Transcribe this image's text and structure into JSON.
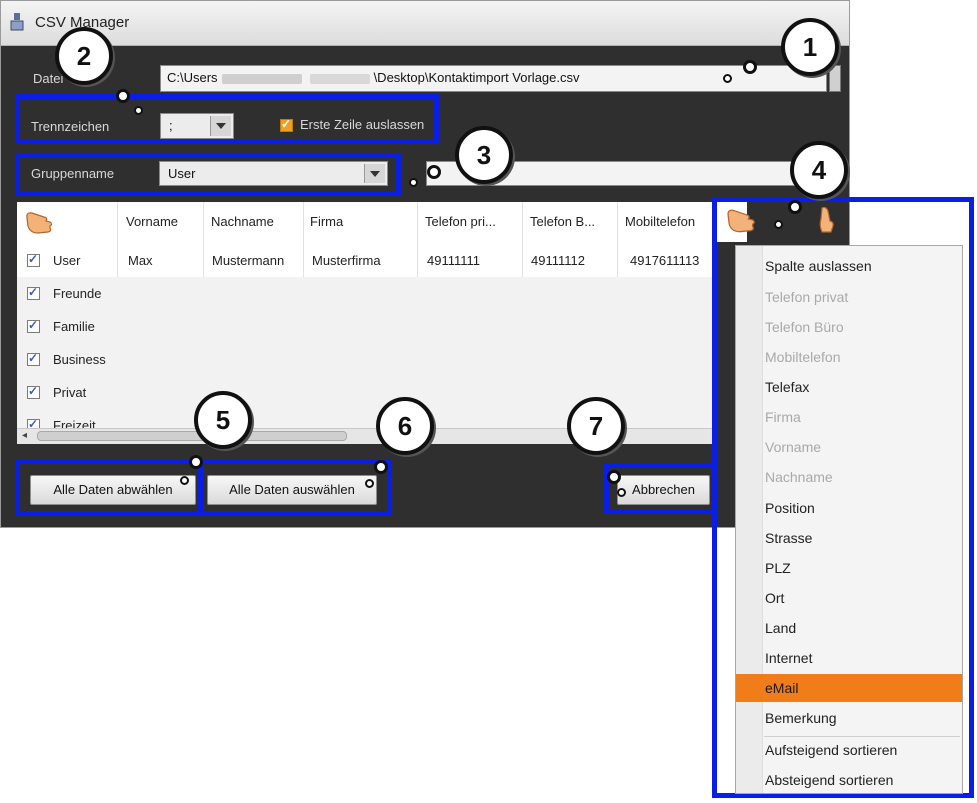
{
  "window": {
    "title": "CSV Manager"
  },
  "file": {
    "label": "Datei",
    "path_prefix": "C:\\Users",
    "path_suffix": "\\Desktop\\Kontaktimport Vorlage.csv"
  },
  "separator": {
    "label": "Trennzeichen",
    "value": ";",
    "skip_first_row_label": "Erste Zeile auslassen",
    "skip_first_row_checked": true
  },
  "group": {
    "label": "Gruppenname",
    "value": "User"
  },
  "table": {
    "columns": [
      "Vorname",
      "Nachname",
      "Firma",
      "Telefon pri...",
      "Telefon B...",
      "Mobiltelefon"
    ],
    "rows": [
      {
        "group": "User",
        "checked": true,
        "values": [
          "Max",
          "Mustermann",
          "Musterfirma",
          "49111111",
          "49111112",
          "4917611113"
        ]
      },
      {
        "group": "Freunde",
        "checked": true,
        "values": [
          "",
          "",
          "",
          "",
          "",
          ""
        ]
      },
      {
        "group": "Familie",
        "checked": true,
        "values": [
          "",
          "",
          "",
          "",
          "",
          ""
        ]
      },
      {
        "group": "Business",
        "checked": true,
        "values": [
          "",
          "",
          "",
          "",
          "",
          ""
        ]
      },
      {
        "group": "Privat",
        "checked": true,
        "values": [
          "",
          "",
          "",
          "",
          "",
          ""
        ]
      },
      {
        "group": "Freizeit",
        "checked": true,
        "values": [
          "",
          "",
          "",
          "",
          "",
          ""
        ]
      }
    ]
  },
  "buttons": {
    "deselect_all": "Alle Daten abwählen",
    "select_all": "Alle Daten auswählen",
    "cancel": "Abbrechen"
  },
  "callouts": [
    "1",
    "2",
    "3",
    "4",
    "5",
    "6",
    "7"
  ],
  "context_menu": {
    "items": [
      {
        "label": "Spalte auslassen",
        "enabled": true
      },
      {
        "label": "Telefon privat",
        "enabled": false
      },
      {
        "label": "Telefon Büro",
        "enabled": false
      },
      {
        "label": "Mobiltelefon",
        "enabled": false
      },
      {
        "label": "Telefax",
        "enabled": true
      },
      {
        "label": "Firma",
        "enabled": false
      },
      {
        "label": "Vorname",
        "enabled": false
      },
      {
        "label": "Nachname",
        "enabled": false
      },
      {
        "label": "Position",
        "enabled": true
      },
      {
        "label": "Strasse",
        "enabled": true
      },
      {
        "label": "PLZ",
        "enabled": true
      },
      {
        "label": "Ort",
        "enabled": true
      },
      {
        "label": "Land",
        "enabled": true
      },
      {
        "label": "Internet",
        "enabled": true
      },
      {
        "label": "eMail",
        "enabled": true,
        "highlighted": true
      },
      {
        "label": "Bemerkung",
        "enabled": true
      },
      {
        "label": "Aufsteigend sortieren",
        "enabled": true
      },
      {
        "label": "Absteigend sortieren",
        "enabled": true
      }
    ]
  },
  "colors": {
    "highlight_box": "#0a1ee6",
    "menu_highlight": "#f07c1a",
    "checkbox_orange": "#f0a020",
    "window_bg": "#2f2f2f"
  },
  "icons": [
    "app-icon",
    "hand-pointer-icon",
    "checkbox-icon",
    "dropdown-arrow-icon"
  ]
}
